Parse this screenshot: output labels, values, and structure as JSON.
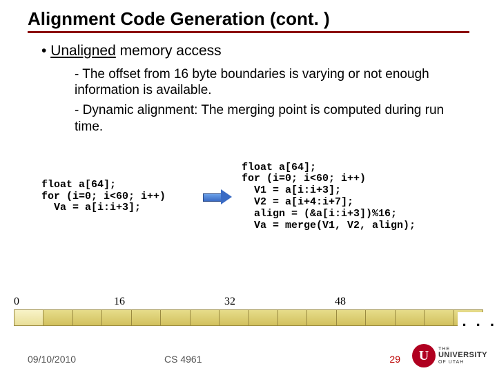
{
  "title": "Alignment Code Generation (cont. )",
  "bullet": {
    "prefix": "• ",
    "word": "Unaligned",
    "rest": " memory access"
  },
  "subs": [
    "- The offset from 16 byte boundaries is varying or not enough information is available.",
    "- Dynamic alignment: The merging point is computed during run time."
  ],
  "code_left": "float a[64];\nfor (i=0; i<60; i++)\n  Va = a[i:i+3];",
  "code_right": "float a[64];\nfor (i=0; i<60; i++)\n  V1 = a[i:i+3];\n  V2 = a[i+4:i+7];\n  align = (&a[i:i+3])%16;\n  Va = merge(V1, V2, align);",
  "ticks": [
    "0",
    "16",
    "32",
    "48"
  ],
  "dots": ". . .",
  "footer": {
    "date": "09/10/2010",
    "course": "CS 4961",
    "page": "29"
  },
  "logo": {
    "letter": "U",
    "line1": "THE",
    "line2": "UNIVERSITY",
    "line3": "OF UTAH"
  }
}
